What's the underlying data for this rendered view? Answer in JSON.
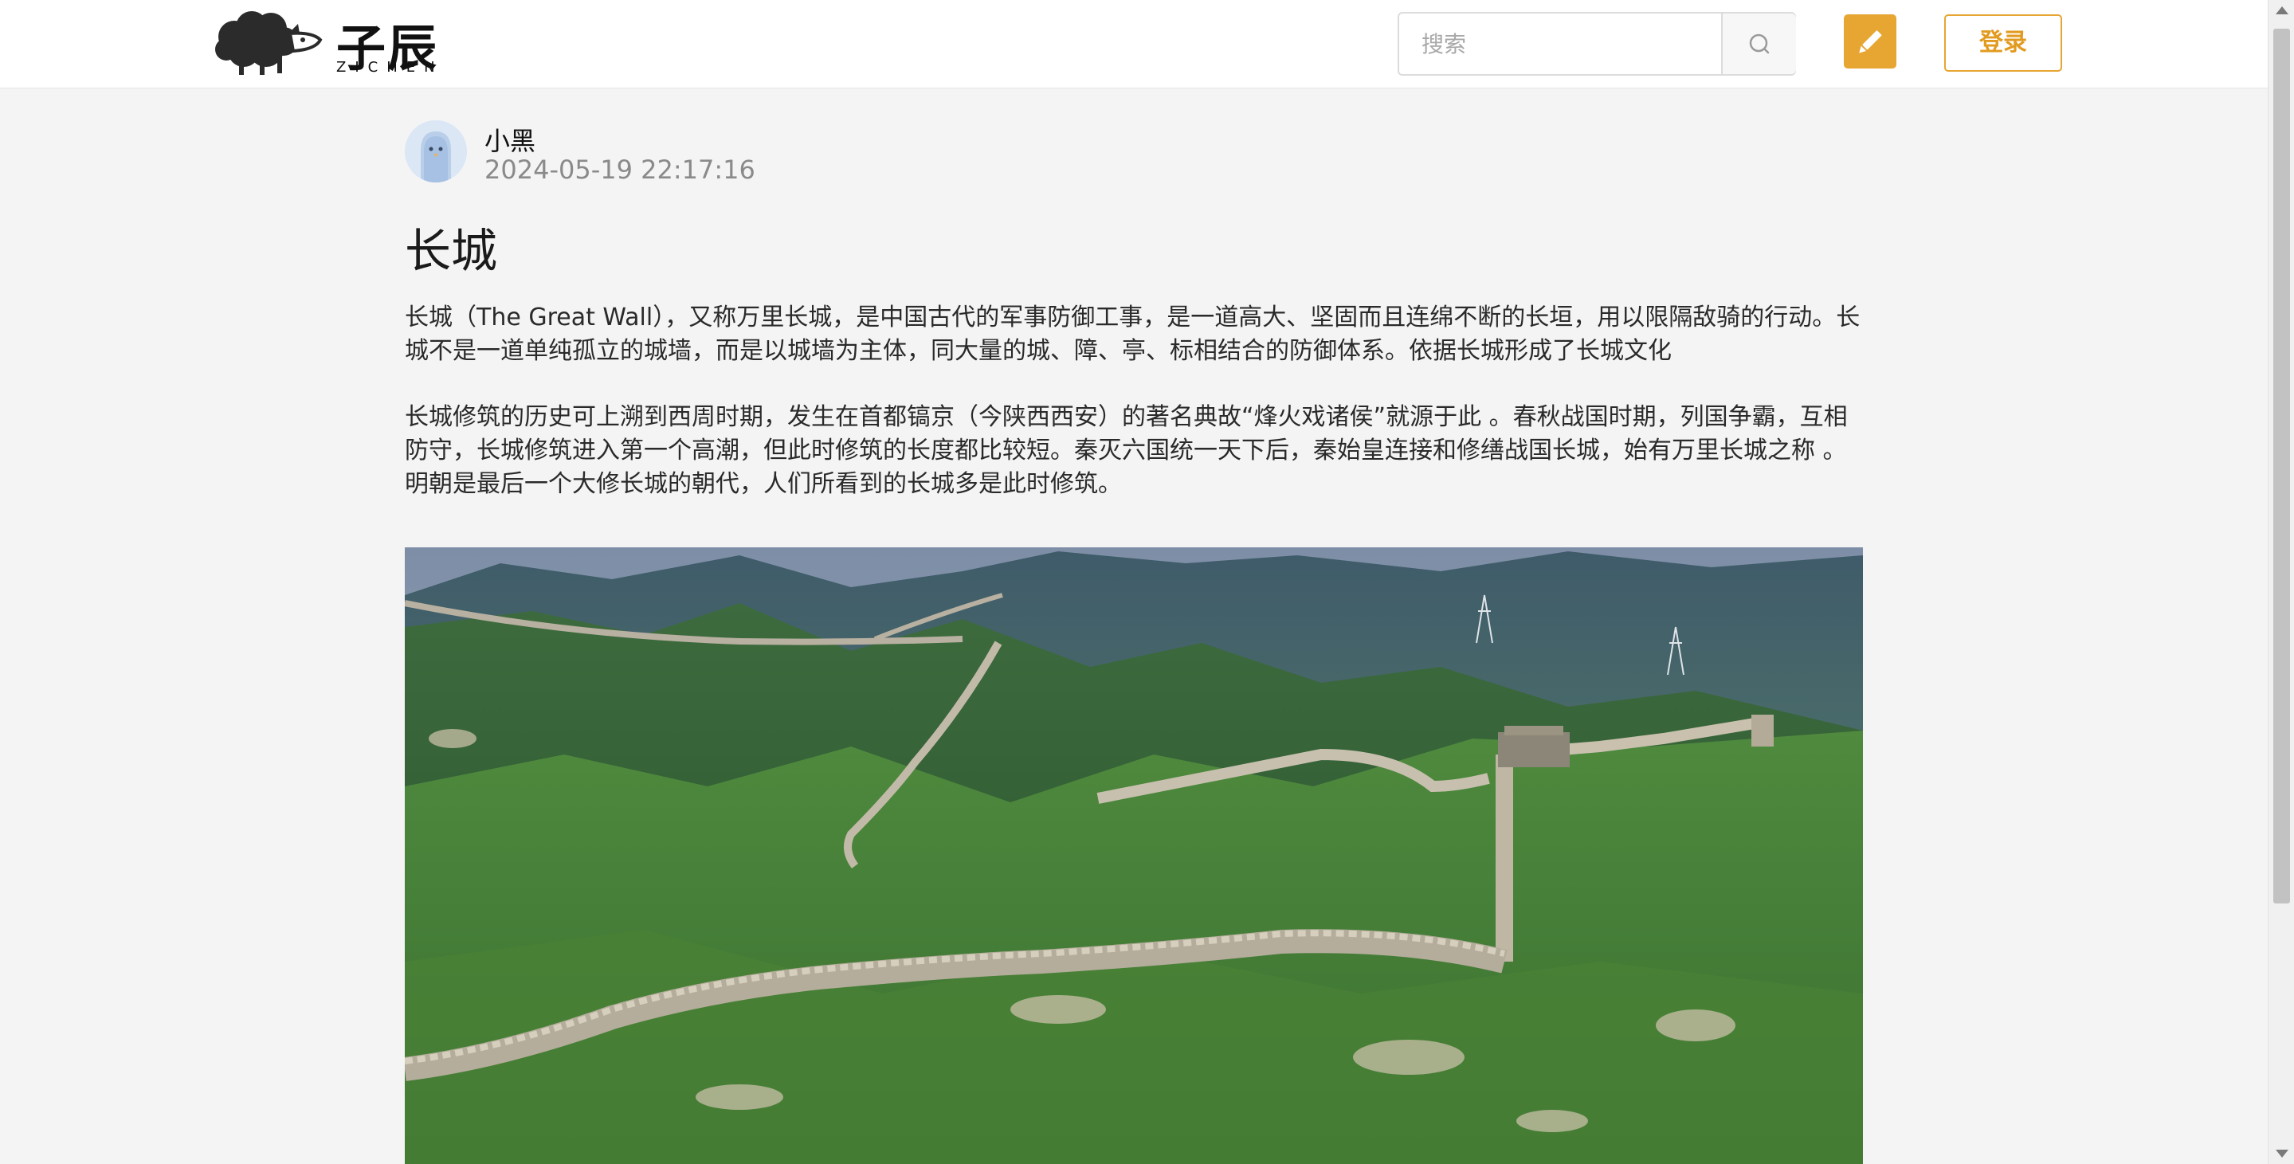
{
  "header": {
    "logo_text": "子辰",
    "logo_sub": "ZICHEN",
    "search_placeholder": "搜索",
    "login_label": "登录"
  },
  "post": {
    "author": "小黑",
    "time": "2024-05-19 22:17:16",
    "title": "长城",
    "paragraphs": [
      "长城（The Great Wall），又称万里长城，是中国古代的军事防御工事，是一道高大、坚固而且连绵不断的长垣，用以限隔敌骑的行动。长城不是一道单纯孤立的城墙，而是以城墙为主体，同大量的城、障、亭、标相结合的防御体系。依据长城形成了长城文化",
      "长城修筑的历史可上溯到西周时期，发生在首都镐京（今陕西西安）的著名典故“烽火戏诸侯”就源于此 。春秋战国时期，列国争霸，互相防守，长城修筑进入第一个高潮，但此时修筑的长度都比较短。秦灭六国统一天下后，秦始皇连接和修缮战国长城，始有万里长城之称 。明朝是最后一个大修长城的朝代，人们所看到的长城多是此时修筑。"
    ]
  },
  "icons": {
    "logo": "sheep-logo-icon",
    "search": "search-icon",
    "edit": "pencil-icon",
    "avatar": "ghost-avatar-icon"
  },
  "colors": {
    "accent": "#e7a532",
    "page_bg": "#f4f4f4",
    "header_bg": "#ffffff"
  }
}
